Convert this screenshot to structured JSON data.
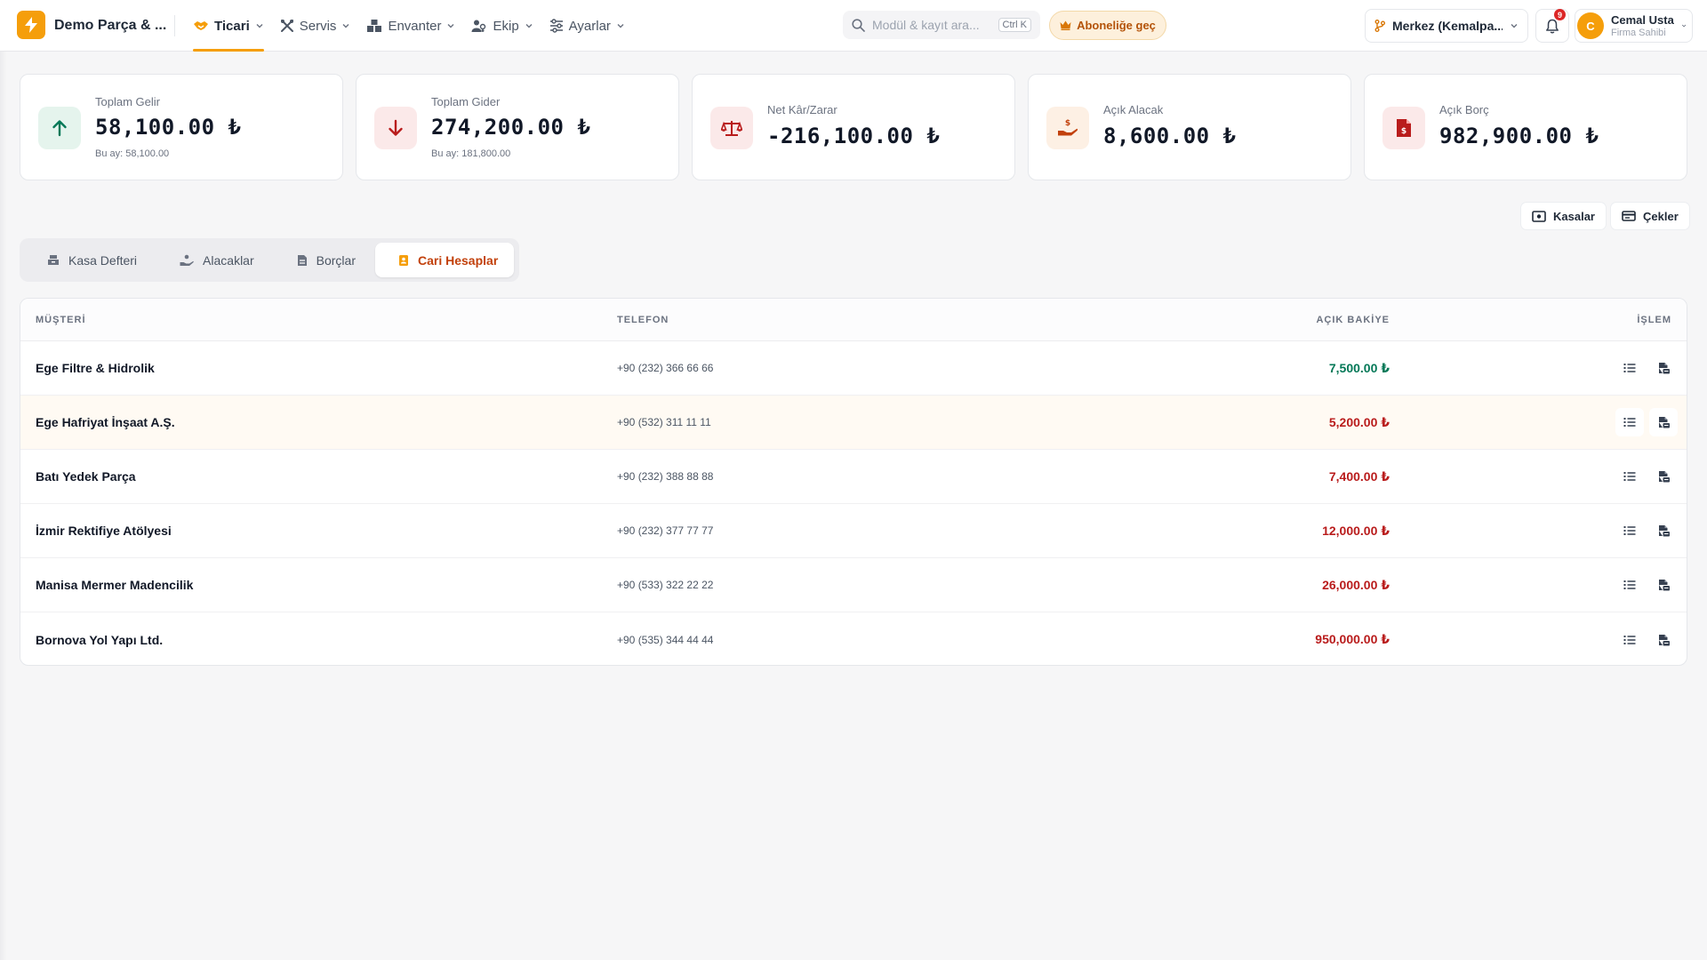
{
  "app": {
    "brand": "Demo Parça & ...",
    "search_placeholder": "Modül & kayıt ara...",
    "search_shortcut": "Ctrl K",
    "upgrade_label": "Aboneliğe geç",
    "branch_label": "Merkez (Kemalpa...",
    "notification_count": "9",
    "user": {
      "initial": "C",
      "name": "Cemal Usta",
      "role": "Firma Sahibi"
    }
  },
  "nav": [
    {
      "label": "Ticari",
      "icon": "handshake-icon",
      "active": true
    },
    {
      "label": "Servis",
      "icon": "tools-icon",
      "active": false
    },
    {
      "label": "Envanter",
      "icon": "boxes-icon",
      "active": false
    },
    {
      "label": "Ekip",
      "icon": "users-icon",
      "active": false
    },
    {
      "label": "Ayarlar",
      "icon": "sliders-icon",
      "active": false
    }
  ],
  "stats": [
    {
      "label": "Toplam Gelir",
      "value": "58,100.00 ₺",
      "sub": "Bu ay: 58,100.00",
      "icon": "arrow-up-icon",
      "color": "#047857",
      "bg": "#e5f4ed"
    },
    {
      "label": "Toplam Gider",
      "value": "274,200.00 ₺",
      "sub": "Bu ay: 181,800.00",
      "icon": "arrow-down-icon",
      "color": "#b91c1c",
      "bg": "#fbe9e9"
    },
    {
      "label": "Net Kâr/Zarar",
      "value": "-216,100.00 ₺",
      "sub": "",
      "icon": "scale-icon",
      "color": "#b91c1c",
      "bg": "#fbe9e9"
    },
    {
      "label": "Açık Alacak",
      "value": "8,600.00 ₺",
      "sub": "",
      "icon": "hand-coin-icon",
      "color": "#c2410c",
      "bg": "#fdf0e4"
    },
    {
      "label": "Açık Borç",
      "value": "982,900.00 ₺",
      "sub": "",
      "icon": "invoice-dollar-icon",
      "color": "#b91c1c",
      "bg": "#fbe9e9"
    }
  ],
  "actions": {
    "kasalar": "Kasalar",
    "cekler": "Çekler"
  },
  "tabs": [
    {
      "label": "Kasa Defteri",
      "icon": "cash-register-icon",
      "active": false
    },
    {
      "label": "Alacaklar",
      "icon": "hand-coin-icon",
      "active": false
    },
    {
      "label": "Borçlar",
      "icon": "invoice-icon",
      "active": false
    },
    {
      "label": "Cari Hesaplar",
      "icon": "contact-book-icon",
      "active": true
    }
  ],
  "table": {
    "columns": {
      "customer": "MÜŞTERİ",
      "phone": "TELEFON",
      "balance": "AÇIK BAKİYE",
      "action": "İŞLEM"
    },
    "rows": [
      {
        "name": "Ege Filtre & Hidrolik",
        "phone": "+90 (232) 366 66 66",
        "balance": "7,500.00 ₺",
        "positive": true
      },
      {
        "name": "Ege Hafriyat İnşaat A.Ş.",
        "phone": "+90 (532) 311 11 11",
        "balance": "5,200.00 ₺",
        "positive": false
      },
      {
        "name": "Batı Yedek Parça",
        "phone": "+90 (232) 388 88 88",
        "balance": "7,400.00 ₺",
        "positive": false
      },
      {
        "name": "İzmir Rektifiye Atölyesi",
        "phone": "+90 (232) 377 77 77",
        "balance": "12,000.00 ₺",
        "positive": false
      },
      {
        "name": "Manisa Mermer Madencilik",
        "phone": "+90 (533) 322 22 22",
        "balance": "26,000.00 ₺",
        "positive": false
      },
      {
        "name": "Bornova Yol Yapı Ltd.",
        "phone": "+90 (535) 344 44 44",
        "balance": "950,000.00 ₺",
        "positive": false
      }
    ]
  },
  "colors": {
    "accent": "#f59e0b",
    "positive": "#047857",
    "negative": "#b91c1c"
  }
}
